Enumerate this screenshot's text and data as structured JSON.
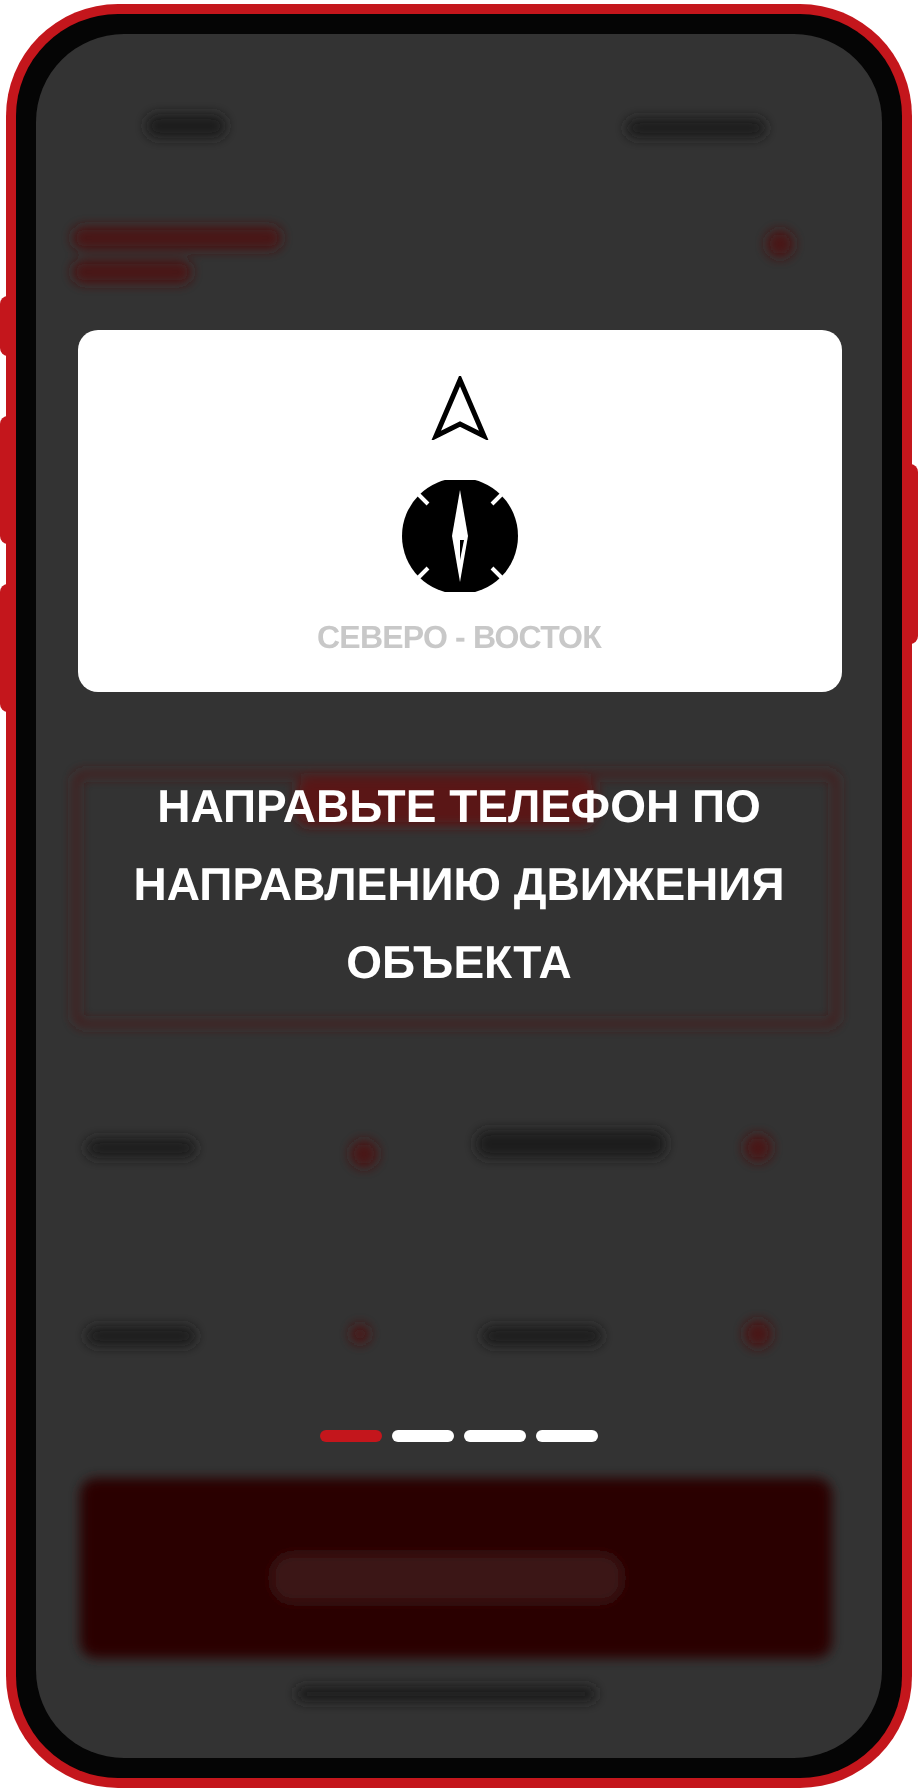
{
  "direction_card": {
    "direction_label": "СЕВЕРО - ВОСТОК"
  },
  "instruction": "НАПРАВЬТЕ ТЕЛЕФОН ПО НАПРАВЛЕНИЮ ДВИЖЕНИЯ ОБЪЕКТА",
  "pager": [
    {
      "selected": true
    },
    {
      "selected": false
    },
    {
      "selected": false
    },
    {
      "selected": false
    }
  ]
}
